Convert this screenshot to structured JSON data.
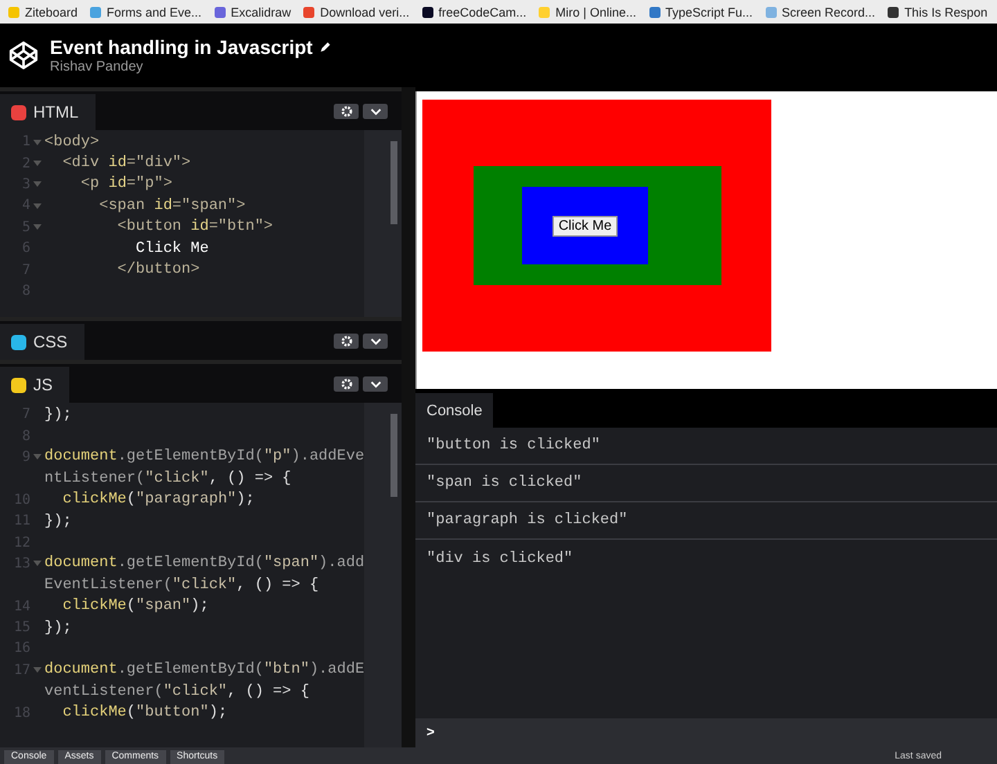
{
  "bookmarks": [
    {
      "label": "Ziteboard",
      "color": "#f5c400"
    },
    {
      "label": "Forms and Eve...",
      "color": "#4aa3df"
    },
    {
      "label": "Excalidraw",
      "color": "#6965db"
    },
    {
      "label": "Download veri...",
      "color": "#e8452c"
    },
    {
      "label": "freeCodeCam...",
      "color": "#0a0a23"
    },
    {
      "label": "Miro | Online...",
      "color": "#ffd02f"
    },
    {
      "label": "TypeScript Fu...",
      "color": "#3178c6"
    },
    {
      "label": "Screen Record...",
      "color": "#7fb2e0"
    },
    {
      "label": "This Is Respon",
      "color": "#333333"
    }
  ],
  "header": {
    "title": "Event handling in Javascript",
    "author": "Rishav Pandey"
  },
  "editors": [
    {
      "kind": "code",
      "label": "HTML",
      "color": "#e8413f",
      "rows": [
        {
          "num": "1",
          "fold": true,
          "tokens": [
            {
              "kind": "tag",
              "text": "<body>"
            }
          ]
        },
        {
          "num": "2",
          "fold": true,
          "tokens": [
            {
              "kind": "tag",
              "text": "  <div "
            },
            {
              "kind": "attr",
              "text": "id"
            },
            {
              "kind": "tag",
              "text": "=\"div\">"
            }
          ]
        },
        {
          "num": "3",
          "fold": true,
          "tokens": [
            {
              "kind": "tag",
              "text": "    <p "
            },
            {
              "kind": "attr",
              "text": "id"
            },
            {
              "kind": "tag",
              "text": "=\"p\">"
            }
          ]
        },
        {
          "num": "4",
          "fold": true,
          "tokens": [
            {
              "kind": "tag",
              "text": "      <span "
            },
            {
              "kind": "attr",
              "text": "id"
            },
            {
              "kind": "tag",
              "text": "=\"span\">"
            }
          ]
        },
        {
          "num": "5",
          "fold": true,
          "tokens": [
            {
              "kind": "tag",
              "text": "        <button "
            },
            {
              "kind": "attr",
              "text": "id"
            },
            {
              "kind": "tag",
              "text": "=\"btn\">"
            }
          ]
        },
        {
          "num": "6",
          "fold": false,
          "tokens": [
            {
              "kind": "plain",
              "text": "          Click Me"
            }
          ]
        },
        {
          "num": "7",
          "fold": false,
          "tokens": [
            {
              "kind": "tag",
              "text": "        </button>"
            }
          ]
        },
        {
          "num": "8",
          "fold": false,
          "tokens": []
        }
      ]
    },
    {
      "kind": "collapsed",
      "label": "CSS",
      "color": "#29b6e8"
    },
    {
      "kind": "code",
      "label": "JS",
      "color": "#f2c81c",
      "rows": [
        {
          "num": "7",
          "fold": false,
          "tokens": [
            {
              "kind": "punct",
              "text": "});"
            }
          ]
        },
        {
          "num": "8",
          "fold": false,
          "tokens": []
        },
        {
          "num": "9",
          "fold": true,
          "tokens": [
            {
              "kind": "ident",
              "text": "document"
            },
            {
              "kind": "method",
              "text": ".getElementById("
            },
            {
              "kind": "str",
              "text": "\"p\""
            },
            {
              "kind": "method",
              "text": ").addEve"
            }
          ]
        },
        {
          "fold": false,
          "tokens": [
            {
              "kind": "method",
              "text": "ntListener("
            },
            {
              "kind": "str",
              "text": "\"click\""
            },
            {
              "kind": "punct",
              "text": ", () => {"
            }
          ]
        },
        {
          "num": "10",
          "fold": false,
          "tokens": [
            {
              "kind": "ident",
              "text": "  clickMe"
            },
            {
              "kind": "punct",
              "text": "("
            },
            {
              "kind": "str",
              "text": "\"paragraph\""
            },
            {
              "kind": "punct",
              "text": ");"
            }
          ]
        },
        {
          "num": "11",
          "fold": false,
          "tokens": [
            {
              "kind": "punct",
              "text": "});"
            }
          ]
        },
        {
          "num": "12",
          "fold": false,
          "tokens": []
        },
        {
          "num": "13",
          "fold": true,
          "tokens": [
            {
              "kind": "ident",
              "text": "document"
            },
            {
              "kind": "method",
              "text": ".getElementById("
            },
            {
              "kind": "str",
              "text": "\"span\""
            },
            {
              "kind": "method",
              "text": ").add"
            }
          ]
        },
        {
          "fold": false,
          "tokens": [
            {
              "kind": "method",
              "text": "EventListener("
            },
            {
              "kind": "str",
              "text": "\"click\""
            },
            {
              "kind": "punct",
              "text": ", () => {"
            }
          ]
        },
        {
          "num": "14",
          "fold": false,
          "tokens": [
            {
              "kind": "ident",
              "text": "  clickMe"
            },
            {
              "kind": "punct",
              "text": "("
            },
            {
              "kind": "str",
              "text": "\"span\""
            },
            {
              "kind": "punct",
              "text": ");"
            }
          ]
        },
        {
          "num": "15",
          "fold": false,
          "tokens": [
            {
              "kind": "punct",
              "text": "});"
            }
          ]
        },
        {
          "num": "16",
          "fold": false,
          "tokens": []
        },
        {
          "num": "17",
          "fold": true,
          "tokens": [
            {
              "kind": "ident",
              "text": "document"
            },
            {
              "kind": "method",
              "text": ".getElementById("
            },
            {
              "kind": "str",
              "text": "\"btn\""
            },
            {
              "kind": "method",
              "text": ").addE"
            }
          ]
        },
        {
          "fold": false,
          "tokens": [
            {
              "kind": "method",
              "text": "ventListener("
            },
            {
              "kind": "str",
              "text": "\"click\""
            },
            {
              "kind": "punct",
              "text": ", () => {"
            }
          ]
        },
        {
          "num": "18",
          "fold": false,
          "tokens": [
            {
              "kind": "ident",
              "text": "  clickMe"
            },
            {
              "kind": "punct",
              "text": "("
            },
            {
              "kind": "str",
              "text": "\"button\""
            },
            {
              "kind": "punct",
              "text": ");"
            }
          ]
        }
      ]
    }
  ],
  "preview": {
    "button": "Click Me"
  },
  "console": {
    "tab": "Console",
    "lines": [
      "\"button is clicked\"",
      "\"span is clicked\"",
      "\"paragraph is clicked\"",
      "\"div is clicked\""
    ],
    "prompt": ">"
  },
  "footer": {
    "tabs": [
      "Console",
      "Assets",
      "Comments",
      "Shortcuts"
    ],
    "status": "Last saved"
  }
}
